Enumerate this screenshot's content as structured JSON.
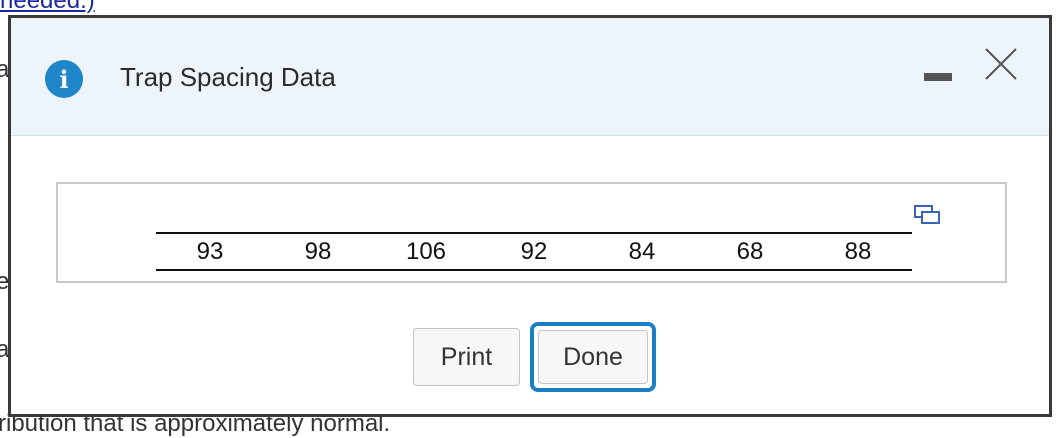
{
  "background": {
    "top_link": "needed.)",
    "left_fragment_1": "a",
    "left_fragment_2": "e",
    "left_fragment_3": "a",
    "bottom_text": "ribution that is approximately normal."
  },
  "dialog": {
    "title": "Trap Spacing Data",
    "info_icon": "info-icon",
    "minimize_icon": "minimize-icon",
    "close_icon": "close-icon",
    "popout_icon": "popout-icon"
  },
  "table": {
    "values": [
      "93",
      "98",
      "106",
      "92",
      "84",
      "68",
      "88"
    ]
  },
  "buttons": {
    "print_label": "Print",
    "done_label": "Done"
  },
  "colors": {
    "accent": "#1a7fc4",
    "header_bg": "#eef5fa",
    "info_icon": "#1e86c9"
  }
}
